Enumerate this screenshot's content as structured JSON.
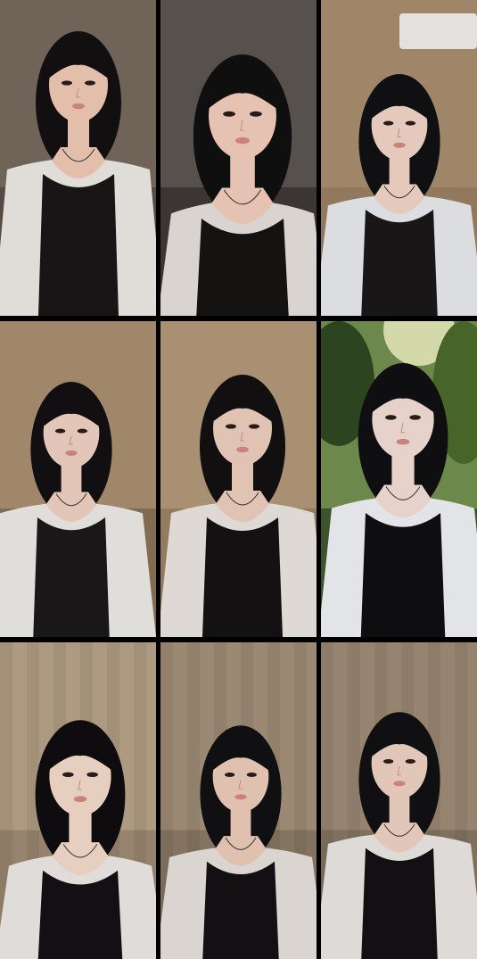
{
  "tiles": [
    {
      "scene": "room-table",
      "bg": "#5b5048",
      "wall": "#8f8172",
      "shirt": "#eeeae6",
      "top": "#1a1718",
      "skin": "#f2cbb6",
      "hair": "#141012"
    },
    {
      "scene": "room-closeup",
      "bg": "#3f3a37",
      "wall": "#777069",
      "shirt": "#e7e2dd",
      "top": "#171414",
      "skin": "#f4cfbe",
      "hair": "#121012"
    },
    {
      "scene": "room-ac",
      "bg": "#9c8164",
      "wall": "#b69a78",
      "shirt": "#e9ebee",
      "top": "#1a1819",
      "skin": "#f3d6c8",
      "hair": "#121014"
    },
    {
      "scene": "room-door",
      "bg": "#8c7258",
      "wall": "#c3a987",
      "shirt": "#efece9",
      "top": "#1b191a",
      "skin": "#f2d3c4",
      "hair": "#131014"
    },
    {
      "scene": "room-cabinet",
      "bg": "#9d8366",
      "wall": "#c6ad8c",
      "shirt": "#ece7e3",
      "top": "#151314",
      "skin": "#efd0bf",
      "hair": "#141012"
    },
    {
      "scene": "outdoor-trees",
      "bg": "#3f5a2e",
      "wall": "#9fbf6c",
      "shirt": "#f1f3f6",
      "top": "#0f0f12",
      "skin": "#f5e0d7",
      "hair": "#101014"
    },
    {
      "scene": "curtain",
      "bg": "#a08c74",
      "wall": "#cdb89b",
      "shirt": "#eeeae8",
      "top": "#141214",
      "skin": "#f6dccc",
      "hair": "#0f0d10"
    },
    {
      "scene": "curtain-hand",
      "bg": "#8d7b66",
      "wall": "#b9a68c",
      "shirt": "#e8e3df",
      "top": "#141214",
      "skin": "#eecdb9",
      "hair": "#121013"
    },
    {
      "scene": "curtain-pose",
      "bg": "#8a7764",
      "wall": "#b3a08a",
      "shirt": "#ece8e6",
      "top": "#141214",
      "skin": "#f1d3c4",
      "hair": "#121013"
    }
  ]
}
